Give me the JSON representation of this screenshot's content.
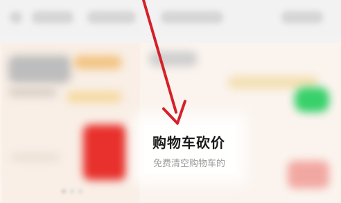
{
  "promo": {
    "title": "购物车砍价",
    "subtitle": "免费清空购物车的"
  },
  "colors": {
    "arrow": "#d4212b",
    "accent_orange": "#f2c483",
    "accent_green": "#38d06a",
    "accent_red": "#e8302c"
  },
  "icons": {
    "pointer_arrow": "arrow-down-icon"
  }
}
